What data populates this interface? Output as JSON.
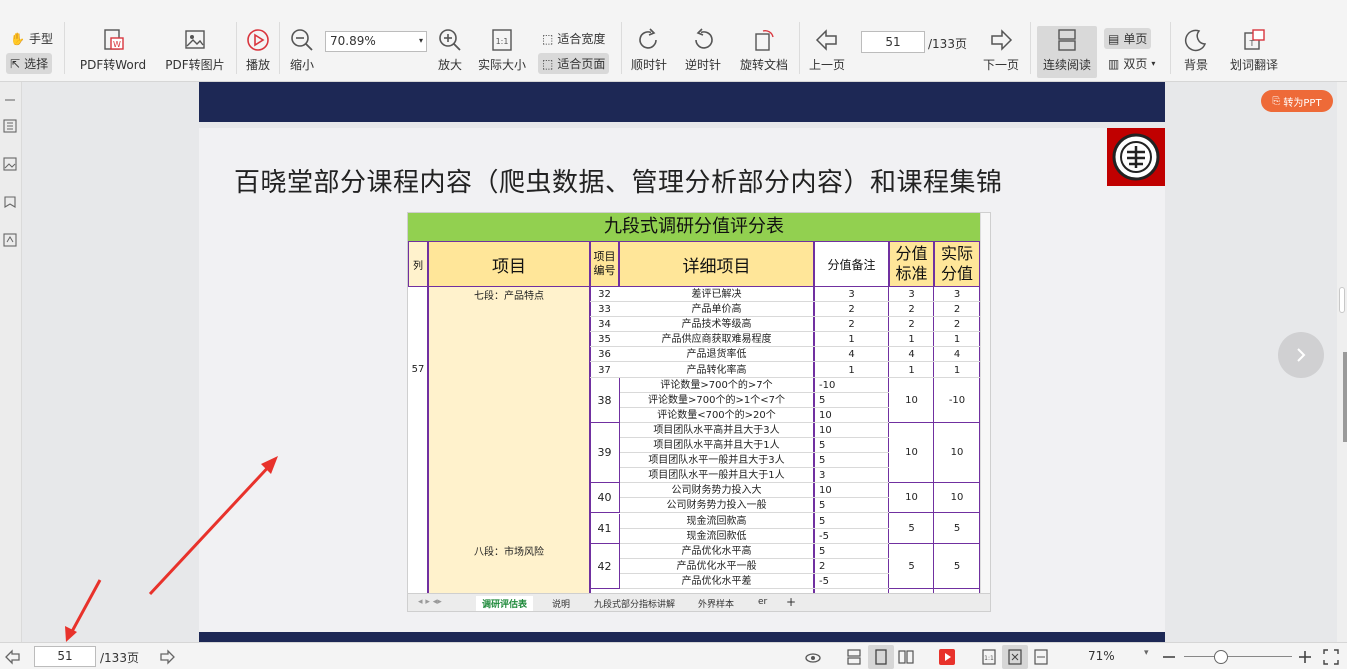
{
  "toolbar": {
    "hand": "手型",
    "select": "选择",
    "pdf_to_word": "PDF转Word",
    "pdf_to_image": "PDF转图片",
    "play": "播放",
    "zoom_out": "缩小",
    "zoom_value": "70.89%",
    "zoom_in": "放大",
    "actual_size": "实际大小",
    "fit_width": "适合宽度",
    "fit_page": "适合页面",
    "rotate_cw": "顺时针",
    "rotate_ccw": "逆时针",
    "rotate_doc": "旋转文档",
    "prev_page": "上一页",
    "page_current": "51",
    "page_total": "/133页",
    "next_page": "下一页",
    "continuous": "连续阅读",
    "single": "单页",
    "double": "双页",
    "background": "背景",
    "translate": "划词翻译"
  },
  "page": {
    "title": "百晓堂部分课程内容（爬虫数据、管理分析部分内容）和课程集锦"
  },
  "sheet": {
    "title": "九段式调研分值评分表",
    "headers": {
      "col": "列",
      "item": "项目",
      "item_no": "项目编号",
      "detail": "详细项目",
      "score_note": "分值备注",
      "score_std": "分值标准",
      "actual": "实际分值"
    },
    "row_marker": "57",
    "section_7": "七段：产品特点",
    "section_8": "八段：市场风险",
    "rows": [
      {
        "no": "32",
        "detail": "差评已解决",
        "note": "3",
        "std": "3",
        "act": "3"
      },
      {
        "no": "33",
        "detail": "产品单价高",
        "note": "2",
        "std": "2",
        "act": "2"
      },
      {
        "no": "34",
        "detail": "产品技术等级高",
        "note": "2",
        "std": "2",
        "act": "2"
      },
      {
        "no": "35",
        "detail": "产品供应商获取难易程度",
        "note": "1",
        "std": "1",
        "act": "1"
      },
      {
        "no": "36",
        "detail": "产品退货率低",
        "note": "4",
        "std": "4",
        "act": "4"
      },
      {
        "no": "37",
        "detail": "产品转化率高",
        "note": "1",
        "std": "1",
        "act": "1"
      }
    ],
    "group38": {
      "no": "38",
      "std": "10",
      "act": "-10",
      "details": [
        "评论数量>700个的>7个",
        "评论数量>700个的>1个<7个",
        "评论数量<700个的>20个"
      ],
      "notes": [
        "-10",
        "5",
        "10"
      ]
    },
    "group39": {
      "no": "39",
      "std": "10",
      "act": "10",
      "details": [
        "项目团队水平高并且大于3人",
        "项目团队水平高并且大于1人",
        "项目团队水平一般并且大于3人",
        "项目团队水平一般并且大于1人"
      ],
      "notes": [
        "10",
        "5",
        "5",
        "3"
      ]
    },
    "group40": {
      "no": "40",
      "std": "10",
      "act": "10",
      "details": [
        "公司财务势力投入大",
        "公司财务势力投入一般"
      ],
      "notes": [
        "10",
        "5"
      ]
    },
    "group41": {
      "no": "41",
      "std": "5",
      "act": "5",
      "details": [
        "现金流回款高",
        "现金流回款低"
      ],
      "notes": [
        "5",
        "-5"
      ]
    },
    "group42": {
      "no": "42",
      "std": "5",
      "act": "5",
      "details": [
        "产品优化水平高",
        "产品优化水平一般",
        "产品优化水平差"
      ],
      "notes": [
        "5",
        "2",
        "-5"
      ]
    },
    "tabs": [
      "调研评估表",
      "说明",
      "九段式部分指标讲解",
      "外界样本",
      "er"
    ]
  },
  "ppt_button": "转为PPT",
  "status": {
    "page_current": "51",
    "page_total": "/133页",
    "zoom": "71%"
  }
}
